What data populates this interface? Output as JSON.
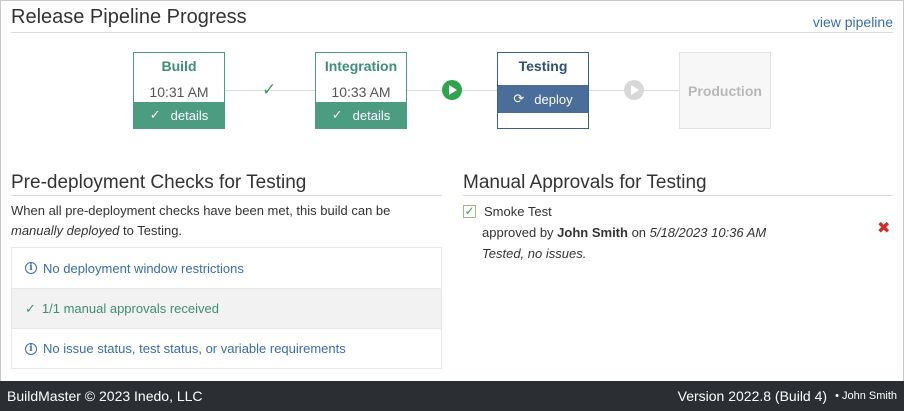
{
  "header": {
    "title": "Release Pipeline Progress",
    "view_link": "view pipeline"
  },
  "pipeline": {
    "stages": [
      {
        "name": "Build",
        "time": "10:31 AM",
        "action": "details",
        "status": "complete"
      },
      {
        "name": "Integration",
        "time": "10:33 AM",
        "action": "details",
        "status": "complete"
      },
      {
        "name": "Testing",
        "time": "",
        "action": "deploy",
        "status": "active"
      },
      {
        "name": "Production",
        "time": "",
        "action": "",
        "status": "pending"
      }
    ],
    "connector_icons": [
      "check-icon",
      "play-icon-green",
      "play-icon-grey"
    ]
  },
  "checks": {
    "title": "Pre-deployment Checks for Testing",
    "desc_part1": "When all pre-deployment checks have been met, this build can be",
    "desc_emph": "manually deployed",
    "desc_part2": " to Testing.",
    "items": [
      {
        "text": "No deployment window restrictions",
        "icon": "info-icon"
      },
      {
        "text": "1/1 manual approvals received",
        "icon": "check-icon"
      },
      {
        "text": "No issue status, test status, or variable requirements",
        "icon": "info-icon"
      }
    ]
  },
  "approvals": {
    "title": "Manual Approvals for Testing",
    "items": [
      {
        "name": "Smoke Test",
        "prefix": "approved by ",
        "approver": "John Smith",
        "on": " on ",
        "when": "5/18/2023 10:36 AM",
        "note": "Tested, no issues."
      }
    ]
  },
  "footer": {
    "left": "BuildMaster © 2023 Inedo, LLC",
    "version": "Version 2022.8 (Build 4)",
    "user": "• John Smith"
  },
  "colors": {
    "complete": "#4b9c80",
    "active": "#4a6d99",
    "pending": "#f7f7f7",
    "link": "#3a6ea5",
    "footer_bg": "#2b2f33",
    "remove": "#c9302c"
  }
}
